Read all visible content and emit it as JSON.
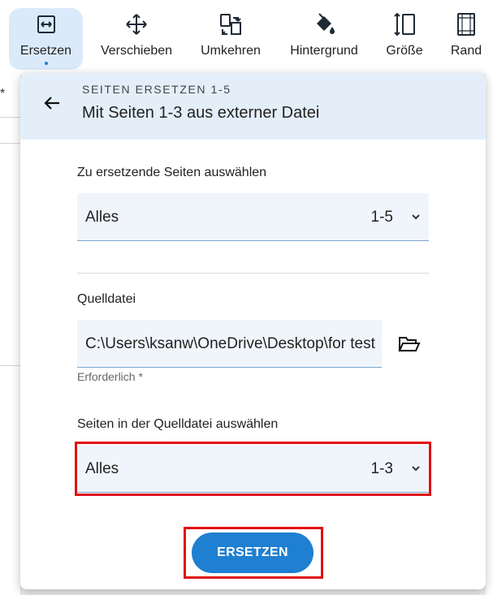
{
  "toolbar": {
    "tools": [
      {
        "label": "Ersetzen",
        "icon": "replace-icon",
        "active": true
      },
      {
        "label": "Verschieben",
        "icon": "move-icon"
      },
      {
        "label": "Umkehren",
        "icon": "reverse-icon"
      },
      {
        "label": "Hintergrund",
        "icon": "paint-bucket-icon"
      },
      {
        "label": "Größe",
        "icon": "resize-icon"
      },
      {
        "label": "Rand",
        "icon": "margin-icon"
      }
    ]
  },
  "background": {
    "left_marker": "*"
  },
  "dialog": {
    "subtitle": "SEITEN ERSETZEN 1-5",
    "title": "Mit Seiten 1-3 aus externer Datei",
    "target_pages": {
      "label": "Zu ersetzende Seiten auswählen",
      "value": "Alles",
      "range": "1-5"
    },
    "source_file": {
      "label": "Quelldatei",
      "value": "C:\\Users\\ksanw\\OneDrive\\Desktop\\for test",
      "hint": "Erforderlich *"
    },
    "source_pages": {
      "label": "Seiten in der Quelldatei auswählen",
      "value": "Alles",
      "range": "1-3"
    },
    "replace_button": "ERSETZEN"
  },
  "colors": {
    "accent": "#1f7fd1",
    "highlight": "#e01010",
    "header_bg": "#e3eef9",
    "active_tool_bg": "#dbeafb"
  }
}
